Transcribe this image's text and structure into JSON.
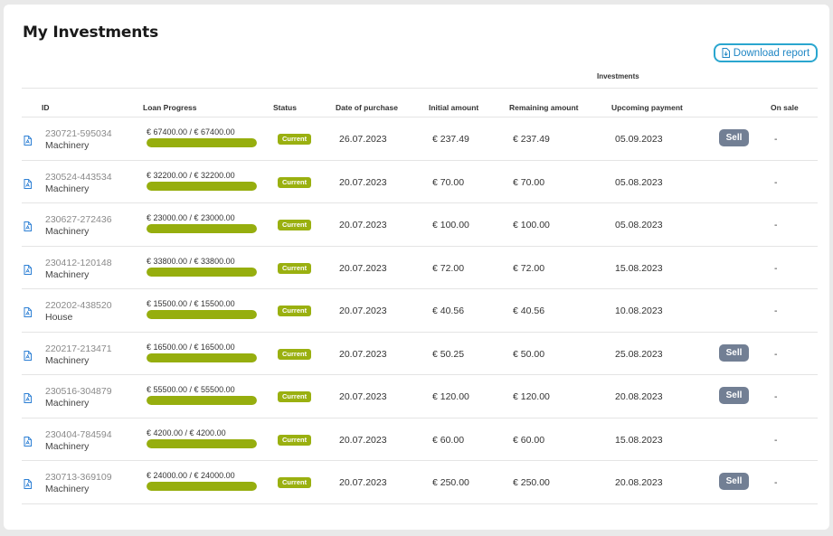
{
  "page": {
    "title": "My Investments"
  },
  "toolbar": {
    "download_label": "Download report"
  },
  "table": {
    "group_header": "Investments",
    "columns": {
      "id": "ID",
      "progress": "Loan Progress",
      "status": "Status",
      "date": "Date of purchase",
      "initial": "Initial amount",
      "remaining": "Remaining amount",
      "upcoming": "Upcoming payment",
      "on_sale": "On sale"
    },
    "rows": [
      {
        "id": "230721-595034",
        "category": "Machinery",
        "progress": "€ 67400.00 / € 67400.00",
        "progress_fraction": 1,
        "status": "Current",
        "date": "26.07.2023",
        "initial": "€ 237.49",
        "remaining": "€ 237.49",
        "upcoming": "05.09.2023",
        "sell": "Sell",
        "on_sale": "-"
      },
      {
        "id": "230524-443534",
        "category": "Machinery",
        "progress": "€ 32200.00 / € 32200.00",
        "progress_fraction": 1,
        "status": "Current",
        "date": "20.07.2023",
        "initial": "€ 70.00",
        "remaining": "€ 70.00",
        "upcoming": "05.08.2023",
        "sell": "",
        "on_sale": "-"
      },
      {
        "id": "230627-272436",
        "category": "Machinery",
        "progress": "€ 23000.00 / € 23000.00",
        "progress_fraction": 1,
        "status": "Current",
        "date": "20.07.2023",
        "initial": "€ 100.00",
        "remaining": "€ 100.00",
        "upcoming": "05.08.2023",
        "sell": "",
        "on_sale": "-"
      },
      {
        "id": "230412-120148",
        "category": "Machinery",
        "progress": "€ 33800.00 / € 33800.00",
        "progress_fraction": 1,
        "status": "Current",
        "date": "20.07.2023",
        "initial": "€ 72.00",
        "remaining": "€ 72.00",
        "upcoming": "15.08.2023",
        "sell": "",
        "on_sale": "-"
      },
      {
        "id": "220202-438520",
        "category": "House",
        "progress": "€ 15500.00 / € 15500.00",
        "progress_fraction": 1,
        "status": "Current",
        "date": "20.07.2023",
        "initial": "€ 40.56",
        "remaining": "€ 40.56",
        "upcoming": "10.08.2023",
        "sell": "",
        "on_sale": "-"
      },
      {
        "id": "220217-213471",
        "category": "Machinery",
        "progress": "€ 16500.00 / € 16500.00",
        "progress_fraction": 1,
        "status": "Current",
        "date": "20.07.2023",
        "initial": "€ 50.25",
        "remaining": "€ 50.00",
        "upcoming": "25.08.2023",
        "sell": "Sell",
        "on_sale": "-"
      },
      {
        "id": "230516-304879",
        "category": "Machinery",
        "progress": "€ 55500.00 / € 55500.00",
        "progress_fraction": 1,
        "status": "Current",
        "date": "20.07.2023",
        "initial": "€ 120.00",
        "remaining": "€ 120.00",
        "upcoming": "20.08.2023",
        "sell": "Sell",
        "on_sale": "-"
      },
      {
        "id": "230404-784594",
        "category": "Machinery",
        "progress": "€ 4200.00 / € 4200.00",
        "progress_fraction": 1,
        "status": "Current",
        "date": "20.07.2023",
        "initial": "€ 60.00",
        "remaining": "€ 60.00",
        "upcoming": "15.08.2023",
        "sell": "",
        "on_sale": "-"
      },
      {
        "id": "230713-369109",
        "category": "Machinery",
        "progress": "€ 24000.00 / € 24000.00",
        "progress_fraction": 1,
        "status": "Current",
        "date": "20.07.2023",
        "initial": "€ 250.00",
        "remaining": "€ 250.00",
        "upcoming": "20.08.2023",
        "sell": "Sell",
        "on_sale": "-"
      }
    ]
  },
  "colors": {
    "accent": "#2aa6cf",
    "progress_fill": "#96ae0e",
    "status_badge": "#9ab010",
    "sell_button": "#727f94",
    "pdf_icon": "#2c7fd4"
  },
  "icons": {
    "download": "document-download-icon",
    "row_document": "pdf-document-icon"
  }
}
